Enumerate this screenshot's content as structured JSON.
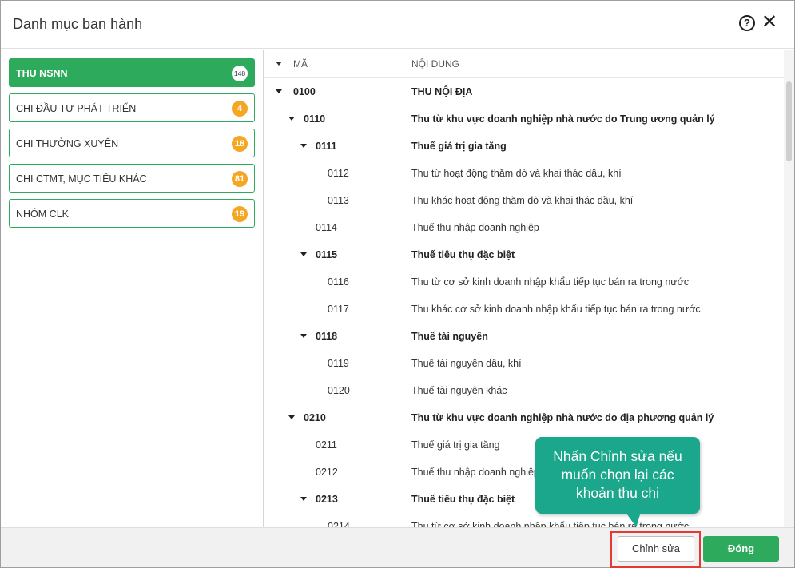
{
  "dialog": {
    "title": "Danh mục ban hành",
    "help_icon": "?",
    "close_icon": "✕"
  },
  "categories": [
    {
      "label": "THU NSNN",
      "count": "148",
      "active": true
    },
    {
      "label": "CHI ĐẦU TƯ PHÁT TRIỂN",
      "count": "4",
      "active": false
    },
    {
      "label": "CHI THƯỜNG XUYÊN",
      "count": "18",
      "active": false
    },
    {
      "label": "CHI CTMT, MỤC TIÊU KHÁC",
      "count": "81",
      "active": false
    },
    {
      "label": "NHÓM CLK",
      "count": "19",
      "active": false
    }
  ],
  "table": {
    "col_code": "MÃ",
    "col_content": "NỘI DUNG",
    "rows": [
      {
        "code": "0100",
        "content": "THU NỘI ĐỊA",
        "level": 0,
        "expandable": true
      },
      {
        "code": "0110",
        "content": "Thu từ khu vực doanh nghiệp nhà nước do Trung ương quản lý",
        "level": 1,
        "expandable": true
      },
      {
        "code": "0111",
        "content": "Thuế giá trị gia tăng",
        "level": 2,
        "expandable": true
      },
      {
        "code": "0112",
        "content": "Thu từ hoạt động thăm dò và khai thác dầu, khí",
        "level": 3,
        "expandable": false
      },
      {
        "code": "0113",
        "content": "Thu khác hoạt động thăm dò và khai thác dầu, khí",
        "level": 3,
        "expandable": false
      },
      {
        "code": "0114",
        "content": "Thuế thu nhập doanh nghiệp",
        "level": 2,
        "expandable": false
      },
      {
        "code": "0115",
        "content": "Thuế tiêu thụ đặc biệt",
        "level": 2,
        "expandable": true
      },
      {
        "code": "0116",
        "content": "Thu từ cơ sở kinh doanh nhập khẩu tiếp tục bán ra trong nước",
        "level": 3,
        "expandable": false
      },
      {
        "code": "0117",
        "content": "Thu khác cơ sở kinh doanh nhập khẩu tiếp tục bán ra trong nước",
        "level": 3,
        "expandable": false
      },
      {
        "code": "0118",
        "content": "Thuế tài nguyên",
        "level": 2,
        "expandable": true
      },
      {
        "code": "0119",
        "content": "Thuế tài nguyên dầu, khí",
        "level": 3,
        "expandable": false
      },
      {
        "code": "0120",
        "content": "Thuế tài nguyên khác",
        "level": 3,
        "expandable": false
      },
      {
        "code": "0210",
        "content": "Thu từ khu vực doanh nghiệp nhà nước do địa phương quản lý",
        "level": 1,
        "expandable": true
      },
      {
        "code": "0211",
        "content": "Thuế giá trị gia tăng",
        "level": 2,
        "expandable": false
      },
      {
        "code": "0212",
        "content": "Thuế thu nhập doanh nghiệp",
        "level": 2,
        "expandable": false
      },
      {
        "code": "0213",
        "content": "Thuế tiêu thụ đặc biệt",
        "level": 2,
        "expandable": true
      },
      {
        "code": "0214",
        "content": "Thu từ cơ sở kinh doanh nhập khẩu tiếp tục bán ra trong nước",
        "level": 3,
        "expandable": false
      }
    ]
  },
  "tooltip": {
    "text_lines": [
      "Nhấn Chỉnh sửa nếu",
      "muốn chọn lại các",
      "khoản thu chi"
    ]
  },
  "footer": {
    "edit_label": "Chỉnh sửa",
    "close_label": "Đóng"
  },
  "colors": {
    "accent_green": "#2eaa5c",
    "badge_orange": "#f5a623",
    "tooltip_teal": "#1aa78c",
    "highlight_red": "#e53935"
  }
}
